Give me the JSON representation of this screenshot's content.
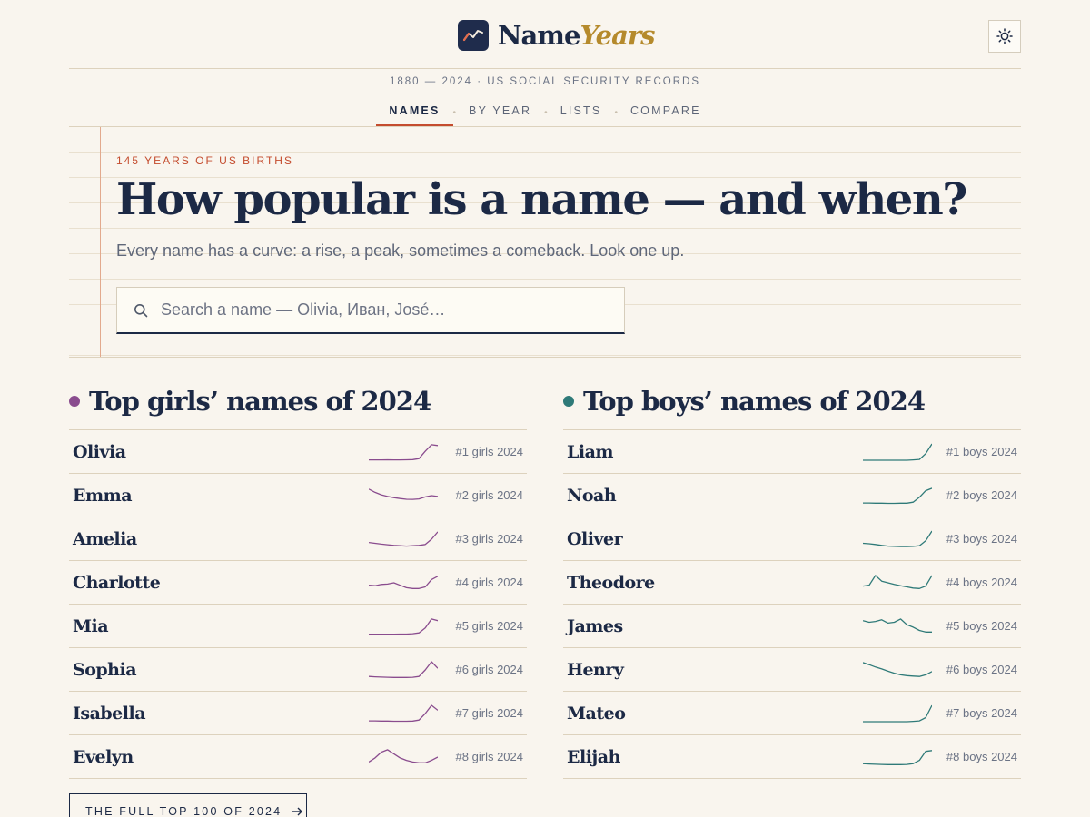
{
  "brand": {
    "name": "Name",
    "accent": "Years"
  },
  "header": {
    "theme_toggle_icon": "sun-icon",
    "meta": "1880 — 2024 · US SOCIAL SECURITY RECORDS"
  },
  "nav": {
    "items": [
      {
        "label": "NAMES",
        "active": true
      },
      {
        "label": "BY YEAR",
        "active": false
      },
      {
        "label": "LISTS",
        "active": false
      },
      {
        "label": "COMPARE",
        "active": false
      }
    ]
  },
  "hero": {
    "kicker": "145 YEARS OF US BIRTHS",
    "headline": "How popular is a name — and when?",
    "subline": "Every name has a curve: a rise, a peak, sometimes a comeback. Look one up.",
    "search_placeholder": "Search a name — Olivia, Иван, José…",
    "search_value": ""
  },
  "girls": {
    "title": "Top girls’ names of 2024",
    "color": "#8a4c8e",
    "rows": [
      {
        "name": "Olivia",
        "rank": "#1 girls 2024",
        "trend": [
          0.02,
          0.02,
          0.02,
          0.03,
          0.02,
          0.02,
          0.03,
          0.04,
          0.1,
          0.55,
          0.95,
          0.9
        ]
      },
      {
        "name": "Emma",
        "rank": "#2 girls 2024",
        "trend": [
          0.9,
          0.7,
          0.55,
          0.45,
          0.38,
          0.32,
          0.28,
          0.27,
          0.3,
          0.42,
          0.5,
          0.45
        ]
      },
      {
        "name": "Amelia",
        "rank": "#3 girls 2024",
        "trend": [
          0.3,
          0.25,
          0.2,
          0.16,
          0.12,
          0.1,
          0.08,
          0.1,
          0.12,
          0.18,
          0.5,
          0.95
        ]
      },
      {
        "name": "Charlotte",
        "rank": "#4 girls 2024",
        "trend": [
          0.35,
          0.32,
          0.4,
          0.42,
          0.5,
          0.35,
          0.2,
          0.15,
          0.15,
          0.25,
          0.7,
          0.9
        ]
      },
      {
        "name": "Mia",
        "rank": "#5 girls 2024",
        "trend": [
          0.02,
          0.02,
          0.02,
          0.02,
          0.02,
          0.03,
          0.03,
          0.05,
          0.1,
          0.4,
          0.95,
          0.85
        ]
      },
      {
        "name": "Sophia",
        "rank": "#6 girls 2024",
        "trend": [
          0.1,
          0.08,
          0.06,
          0.05,
          0.04,
          0.04,
          0.04,
          0.05,
          0.1,
          0.5,
          1.0,
          0.6
        ]
      },
      {
        "name": "Isabella",
        "rank": "#7 girls 2024",
        "trend": [
          0.05,
          0.05,
          0.04,
          0.04,
          0.03,
          0.03,
          0.03,
          0.04,
          0.1,
          0.5,
          1.0,
          0.7
        ]
      },
      {
        "name": "Evelyn",
        "rank": "#8 girls 2024",
        "trend": [
          0.2,
          0.45,
          0.8,
          0.95,
          0.7,
          0.45,
          0.3,
          0.2,
          0.15,
          0.15,
          0.3,
          0.5
        ]
      }
    ]
  },
  "boys": {
    "title": "Top boys’ names of 2024",
    "color": "#2f7a78",
    "rows": [
      {
        "name": "Liam",
        "rank": "#1 boys 2024",
        "trend": [
          0.0,
          0.0,
          0.0,
          0.0,
          0.0,
          0.0,
          0.0,
          0.0,
          0.02,
          0.05,
          0.4,
          1.0
        ]
      },
      {
        "name": "Noah",
        "rank": "#2 boys 2024",
        "trend": [
          0.05,
          0.05,
          0.04,
          0.04,
          0.03,
          0.03,
          0.04,
          0.04,
          0.1,
          0.4,
          0.8,
          0.95
        ]
      },
      {
        "name": "Oliver",
        "rank": "#3 boys 2024",
        "trend": [
          0.25,
          0.22,
          0.18,
          0.12,
          0.08,
          0.06,
          0.05,
          0.05,
          0.06,
          0.1,
          0.4,
          1.0
        ]
      },
      {
        "name": "Theodore",
        "rank": "#4 boys 2024",
        "trend": [
          0.3,
          0.35,
          0.95,
          0.6,
          0.5,
          0.4,
          0.32,
          0.25,
          0.18,
          0.15,
          0.3,
          0.95
        ]
      },
      {
        "name": "James",
        "rank": "#5 boys 2024",
        "trend": [
          0.85,
          0.75,
          0.8,
          0.9,
          0.7,
          0.75,
          0.95,
          0.6,
          0.45,
          0.25,
          0.15,
          0.15
        ]
      },
      {
        "name": "Henry",
        "rank": "#6 boys 2024",
        "trend": [
          0.95,
          0.82,
          0.68,
          0.56,
          0.42,
          0.3,
          0.2,
          0.15,
          0.12,
          0.1,
          0.2,
          0.4
        ]
      },
      {
        "name": "Mateo",
        "rank": "#7 boys 2024",
        "trend": [
          0.0,
          0.0,
          0.0,
          0.0,
          0.0,
          0.0,
          0.0,
          0.0,
          0.02,
          0.05,
          0.25,
          1.0
        ]
      },
      {
        "name": "Elijah",
        "rank": "#8 boys 2024",
        "trend": [
          0.1,
          0.08,
          0.06,
          0.05,
          0.04,
          0.04,
          0.04,
          0.05,
          0.1,
          0.3,
          0.85,
          0.9
        ]
      }
    ]
  },
  "footer": {
    "full_list_label": "THE FULL TOP 100 OF 2024",
    "arrow_icon": "arrow-right-icon"
  }
}
